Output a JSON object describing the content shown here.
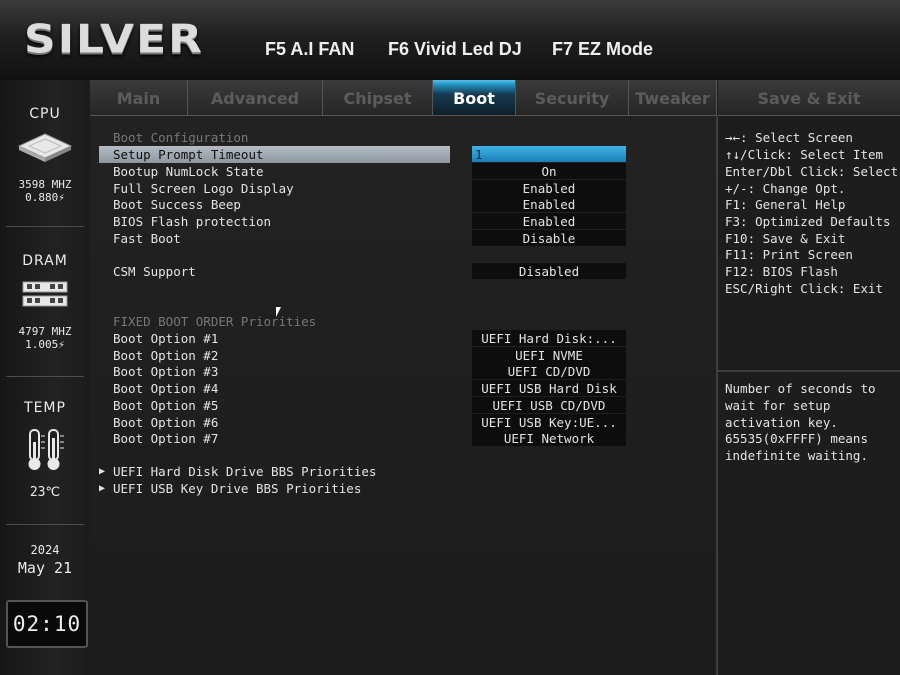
{
  "brand": "SILVER",
  "fkeys": [
    "F5 A.I FAN",
    "F6 Vivid Led DJ",
    "F7 EZ Mode"
  ],
  "sidebar": {
    "cpu": {
      "title": "CPU",
      "freq": "3598 MHZ",
      "volt": "0.880⚡"
    },
    "dram": {
      "title": "DRAM",
      "freq": "4797 MHZ",
      "volt": "1.005⚡"
    },
    "temp": {
      "title": "TEMP",
      "value": "23℃"
    },
    "date": {
      "year": "2024",
      "month_day": "May 21"
    },
    "time": "02:10"
  },
  "tabs": [
    "Main",
    "Advanced",
    "Chipset",
    "Boot",
    "Security",
    "Tweaker",
    "Save & Exit"
  ],
  "active_tab": "Boot",
  "main": {
    "boot_config_header": "Boot Configuration",
    "settings": [
      {
        "label": "Setup Prompt Timeout",
        "value": "1"
      },
      {
        "label": "Bootup NumLock State",
        "value": "On"
      },
      {
        "label": "Full Screen Logo Display",
        "value": "Enabled"
      },
      {
        "label": "Boot Success Beep",
        "value": "Enabled"
      },
      {
        "label": "BIOS Flash protection",
        "value": "Enabled"
      },
      {
        "label": "Fast Boot",
        "value": "Disable"
      }
    ],
    "csm": {
      "label": "CSM Support",
      "value": "Disabled"
    },
    "fixed_order_header": "FIXED BOOT ORDER Priorities",
    "boot_options": [
      {
        "label": "Boot Option #1",
        "value": "UEFI Hard Disk:..."
      },
      {
        "label": "Boot Option #2",
        "value": "UEFI NVME"
      },
      {
        "label": "Boot Option #3",
        "value": "UEFI CD/DVD"
      },
      {
        "label": "Boot Option #4",
        "value": "UEFI USB Hard Disk"
      },
      {
        "label": "Boot Option #5",
        "value": "UEFI USB CD/DVD"
      },
      {
        "label": "Boot Option #6",
        "value": "UEFI USB Key:UE..."
      },
      {
        "label": "Boot Option #7",
        "value": "UEFI Network"
      }
    ],
    "submenus": [
      "UEFI Hard Disk Drive BBS Priorities",
      "UEFI USB Key Drive BBS Priorities"
    ]
  },
  "help": {
    "keys": [
      "→←: Select Screen",
      "↑↓/Click: Select Item",
      "Enter/Dbl Click: Select",
      "+/-: Change Opt.",
      "F1: General Help",
      "F3: Optimized Defaults",
      "F10: Save & Exit",
      "F11: Print Screen",
      "F12: BIOS Flash",
      "ESC/Right Click: Exit"
    ],
    "description": [
      "Number of seconds to",
      "wait for setup",
      "activation key.",
      "65535(0xFFFF) means",
      "indefinite waiting."
    ]
  },
  "colors": {
    "active_tab": "#2596c8",
    "highlight": "#a3aab3",
    "value_edit": "#3fb3e6"
  }
}
